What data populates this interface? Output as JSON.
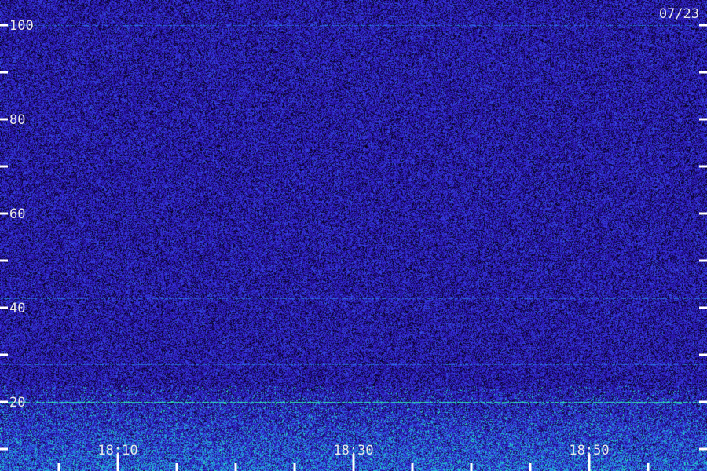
{
  "chart_data": {
    "type": "heatmap",
    "title": "",
    "date": "07/23",
    "xlabel": "",
    "ylabel": "",
    "ylim": [
      0,
      100
    ],
    "y_ticks_labeled": [
      20,
      40,
      60,
      80,
      100
    ],
    "y_ticks_minor": [
      10,
      30,
      50,
      70,
      90
    ],
    "x_time_range": [
      "18:05",
      "18:59"
    ],
    "x_ticks_labeled": [
      "18:10",
      "18:30",
      "18:50"
    ],
    "x_ticks_minor": [
      "18:05",
      "18:15",
      "18:20",
      "18:25",
      "18:35",
      "18:40",
      "18:45",
      "18:55"
    ],
    "colormap": [
      "#000000",
      "#1a0866",
      "#2a14b4",
      "#3a3ce6",
      "#1fa0e0",
      "#22d8c8",
      "#40ff90"
    ],
    "features": {
      "noise_floor_level": 0.45,
      "strong_band_below": 20,
      "horizontal_line_at": 20,
      "faint_lines_at": [
        100,
        28,
        42
      ]
    }
  }
}
